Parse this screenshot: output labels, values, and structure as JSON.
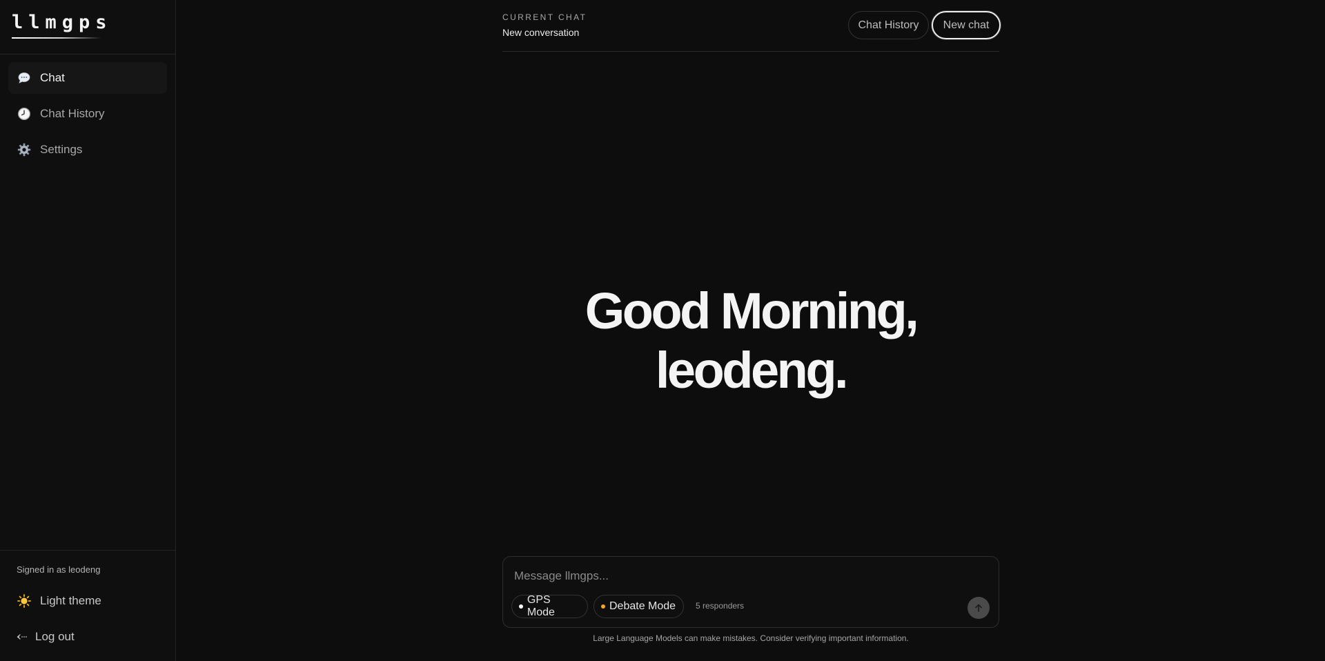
{
  "sidebar": {
    "logo": "llmgps",
    "nav": [
      {
        "label": "Chat",
        "icon": "speech-bubble-icon",
        "active": true
      },
      {
        "label": "Chat History",
        "icon": "clock-icon",
        "active": false
      },
      {
        "label": "Settings",
        "icon": "gear-icon",
        "active": false
      }
    ],
    "signed_in": "Signed in as leodeng",
    "theme_label": "Light theme",
    "theme_icon": "sun-icon",
    "logout_label": "Log out",
    "logout_icon": "logout-arrow-icon"
  },
  "header": {
    "current_chat_label": "CURRENT CHAT",
    "current_chat_title": "New conversation",
    "history_button": "Chat History",
    "new_chat_button": "New chat"
  },
  "main": {
    "greeting": "Good Morning, leodeng."
  },
  "composer": {
    "placeholder": "Message llmgps...",
    "gps_mode": "GPS Mode",
    "debate_mode": "Debate Mode",
    "responders": "5 responders",
    "gps_dot_color": "#ffffff",
    "debate_dot_color": "#f5a623"
  },
  "footer": {
    "disclaimer": "Large Language Models can make mistakes. Consider verifying important information."
  },
  "colors": {
    "background": "#0d0d0d",
    "sidebar_bg": "#0f0f0f",
    "accent_text": "#f4f4f4"
  }
}
